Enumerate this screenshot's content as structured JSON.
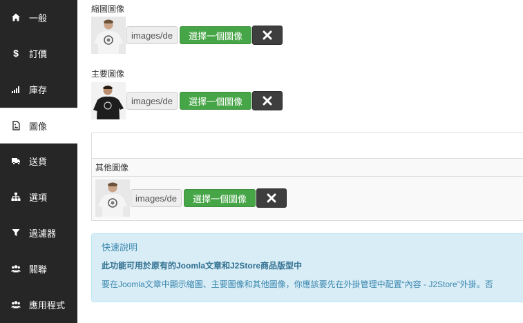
{
  "sidebar": {
    "items": [
      {
        "label": "一般",
        "icon": "home-icon"
      },
      {
        "label": "訂價",
        "icon": "dollar-icon"
      },
      {
        "label": "庫存",
        "icon": "signal-icon"
      },
      {
        "label": "圖像",
        "icon": "image-file-icon",
        "active": true
      },
      {
        "label": "送貨",
        "icon": "truck-icon"
      },
      {
        "label": "選項",
        "icon": "sitemap-icon"
      },
      {
        "label": "過濾器",
        "icon": "filter-icon"
      },
      {
        "label": "關聯",
        "icon": "users-icon"
      },
      {
        "label": "應用程式",
        "icon": "users-icon"
      }
    ]
  },
  "thumbnail": {
    "label": "縮圖圖像",
    "path": "images/de",
    "select_label": "選擇一個圖像",
    "clear_icon": "x-icon"
  },
  "main_image": {
    "label": "主要圖像",
    "path": "images/de",
    "select_label": "選擇一個圖像",
    "clear_icon": "x-icon"
  },
  "other_images": {
    "label": "其他圖像",
    "path": "images/de",
    "select_label": "選擇一個圖像",
    "clear_icon": "x-icon"
  },
  "help": {
    "title": "快速說明",
    "bold_text": "此功能可用於原有的Joomla文章和J2Store商品版型中",
    "description": "要在Joomla文章中顯示縮圖、主要圖像和其他圖像，你應該要先在外掛管理中配置“內容 - J2Store”外掛。否"
  },
  "colors": {
    "sidebar_bg": "#262626",
    "select_button": "#46a546",
    "clear_button": "#3e3e3e",
    "alert_bg": "#d9edf7",
    "alert_text": "#3a87ad"
  }
}
